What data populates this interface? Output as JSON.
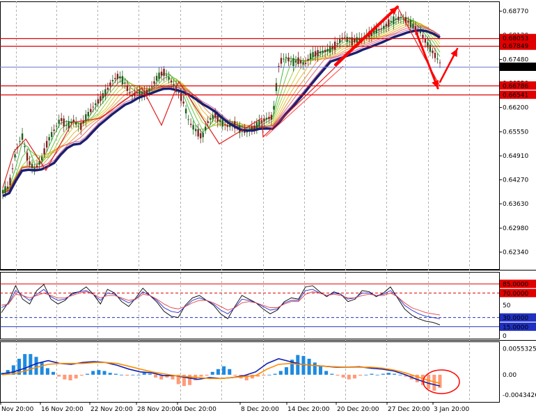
{
  "colors": {
    "background": "#ffffff",
    "grid": "#b0b0b0",
    "level_line": "#e00000",
    "price_line": "#6a78d0",
    "ma_thick": "#1c1f6e",
    "label_fill": "#e00000",
    "label_text": "#ffffff",
    "current_fill": "#000000",
    "osc_level_fill": "#2030c0",
    "arrow": "#ff0000",
    "macd_pos": "#1e8ae0",
    "macd_neg": "#ff9b78",
    "macd_line": "#1020b0",
    "signal_line": "#ff8c00",
    "circle": "#ff0000"
  },
  "chart_data": [
    {
      "type": "line",
      "panel": "price",
      "ylim": [
        0.6211,
        0.6892
      ],
      "y_ticks": [
        "0.68770",
        "0.68130",
        "0.67480",
        "0.66850",
        "0.66200",
        "0.65550",
        "0.64910",
        "0.64270",
        "0.63630",
        "0.62980",
        "0.62340"
      ],
      "levels": [
        "0.68053",
        "0.67849",
        "0.66786",
        "0.66541"
      ],
      "current_price": "0.67278",
      "series": [
        {
          "values": [
            0.6395,
            0.641,
            0.65,
            0.6545,
            0.6475,
            0.6455,
            0.648,
            0.653,
            0.656,
            0.659,
            0.657,
            0.6585,
            0.6565,
            0.6595,
            0.662,
            0.664,
            0.666,
            0.669,
            0.6705,
            0.6685,
            0.665,
            0.666,
            0.6655,
            0.667,
            0.67,
            0.6715,
            0.6695,
            0.667,
            0.664,
            0.658,
            0.656,
            0.654,
            0.6585,
            0.66,
            0.658,
            0.657,
            0.6575,
            0.656,
            0.6555,
            0.6565,
            0.658,
            0.659,
            0.6595,
            0.674,
            0.6755,
            0.674,
            0.6745,
            0.6735,
            0.676,
            0.6765,
            0.677,
            0.6775,
            0.679,
            0.681,
            0.6795,
            0.68,
            0.6805,
            0.6815,
            0.6825,
            0.683,
            0.6845,
            0.6855,
            0.686,
            0.685,
            0.6835,
            0.682,
            0.679,
            0.6765,
            0.674
          ]
        }
      ]
    },
    {
      "type": "line",
      "panel": "oscillator",
      "ylim": [
        0,
        100
      ],
      "y_ticks": [
        "85.0000",
        "70.0000",
        "50",
        "30.0000",
        "15.0000",
        "0"
      ],
      "series": [
        {
          "values": [
            38,
            55,
            82,
            60,
            52,
            74,
            84,
            60,
            52,
            58,
            70,
            72,
            80,
            68,
            52,
            76,
            70,
            56,
            48,
            62,
            78,
            66,
            55,
            40,
            32,
            30,
            50,
            62,
            66,
            58,
            50,
            36,
            28,
            48,
            66,
            60,
            54,
            44,
            36,
            42,
            56,
            62,
            60,
            80,
            82,
            72,
            64,
            72,
            68,
            56,
            60,
            74,
            72,
            64,
            70,
            80,
            62,
            44,
            34,
            28,
            24,
            22,
            18
          ]
        },
        {
          "values": [
            46,
            52,
            74,
            66,
            58,
            68,
            76,
            64,
            58,
            60,
            68,
            72,
            74,
            68,
            58,
            70,
            68,
            60,
            54,
            60,
            72,
            66,
            58,
            46,
            40,
            38,
            48,
            58,
            62,
            58,
            52,
            42,
            36,
            46,
            60,
            58,
            54,
            48,
            42,
            44,
            54,
            58,
            58,
            74,
            76,
            70,
            66,
            70,
            68,
            60,
            62,
            70,
            70,
            66,
            68,
            74,
            64,
            50,
            42,
            36,
            32,
            30,
            28
          ]
        },
        {
          "values": [
            50,
            52,
            68,
            66,
            62,
            66,
            70,
            66,
            62,
            62,
            66,
            70,
            72,
            68,
            62,
            66,
            66,
            62,
            58,
            60,
            68,
            66,
            60,
            52,
            46,
            44,
            48,
            54,
            58,
            58,
            54,
            48,
            42,
            46,
            54,
            56,
            54,
            50,
            46,
            46,
            52,
            56,
            56,
            68,
            72,
            70,
            66,
            68,
            66,
            62,
            62,
            66,
            68,
            66,
            66,
            70,
            64,
            54,
            46,
            42,
            38,
            36,
            34
          ]
        }
      ]
    },
    {
      "type": "bar",
      "panel": "macd",
      "ylim": [
        -0.0049,
        0.0062
      ],
      "y_ticks": [
        "0.0055325",
        "0.00",
        "-0.0043426"
      ],
      "histogram": [
        0.0004,
        0.001,
        0.002,
        0.0034,
        0.0044,
        0.0044,
        0.0038,
        0.0026,
        0.0014,
        0.0006,
        -0.0004,
        -0.001,
        -0.0012,
        -0.0008,
        -0.0002,
        0.0002,
        0.0008,
        0.001,
        0.0008,
        0.0004,
        0.0002,
        0.0,
        -0.0002,
        0.0,
        0.0,
        0.0004,
        0.0002,
        -0.0006,
        -0.001,
        -0.0006,
        -0.001,
        -0.002,
        -0.0024,
        -0.0022,
        -0.0012,
        -0.0004,
        -0.0002,
        0.0006,
        0.0012,
        0.0018,
        0.0012,
        -0.0002,
        -0.0008,
        -0.0012,
        -0.0008,
        -0.0004,
        -0.0002,
        0.0,
        0.0002,
        0.0008,
        0.0016,
        0.0032,
        0.0042,
        0.004,
        0.0034,
        0.0026,
        0.0018,
        0.0008,
        0.0002,
        -0.0002,
        -0.0006,
        -0.001,
        -0.0008,
        -0.0002,
        0.0,
        0.0002,
        0.0,
        0.0002,
        0.0004,
        0.0002,
        0.0,
        -0.0004,
        -0.001,
        -0.0016,
        -0.0022,
        -0.003,
        -0.0034,
        -0.0028
      ],
      "series": [
        {
          "values": [
            0.0002,
            0.0006,
            0.0014,
            0.0024,
            0.003,
            0.0024,
            0.0022,
            0.0026,
            0.0028,
            0.0026,
            0.002,
            0.0012,
            0.0006,
            0.0004,
            -0.0002,
            -0.0002,
            -0.0006,
            -0.001,
            -0.0006,
            -0.0008,
            -0.0006,
            -0.0002,
            0.0006,
            0.0024,
            0.0034,
            0.0028,
            0.0022,
            0.002,
            0.0018,
            0.0016,
            0.0016,
            0.0017,
            0.0014,
            0.0012,
            0.0008,
            0.0,
            -0.001,
            -0.0018,
            -0.0024
          ]
        },
        {
          "values": [
            0.0,
            0.0002,
            0.0008,
            0.0016,
            0.0022,
            0.0024,
            0.0024,
            0.0024,
            0.0026,
            0.0026,
            0.0024,
            0.0018,
            0.0012,
            0.0006,
            0.0002,
            -0.0002,
            -0.0004,
            -0.0006,
            -0.0008,
            -0.0008,
            -0.0006,
            -0.0004,
            -0.0002,
            0.0012,
            0.0022,
            0.0024,
            0.0022,
            0.002,
            0.0018,
            0.0017,
            0.0016,
            0.0016,
            0.0016,
            0.0014,
            0.001,
            0.0004,
            -0.0004,
            -0.0012,
            -0.0018
          ]
        }
      ]
    }
  ],
  "x_axis": {
    "tick_labels": [
      "Nov 20:00",
      "16 Nov 20:00",
      "22 Nov 20:00",
      "28 Nov 20:00",
      "4 Dec 20:00",
      "8 Dec 20:00",
      "14 Dec 20:00",
      "20 Dec 20:00",
      "27 Dec 20:00",
      "3 Jan 20:00"
    ]
  }
}
